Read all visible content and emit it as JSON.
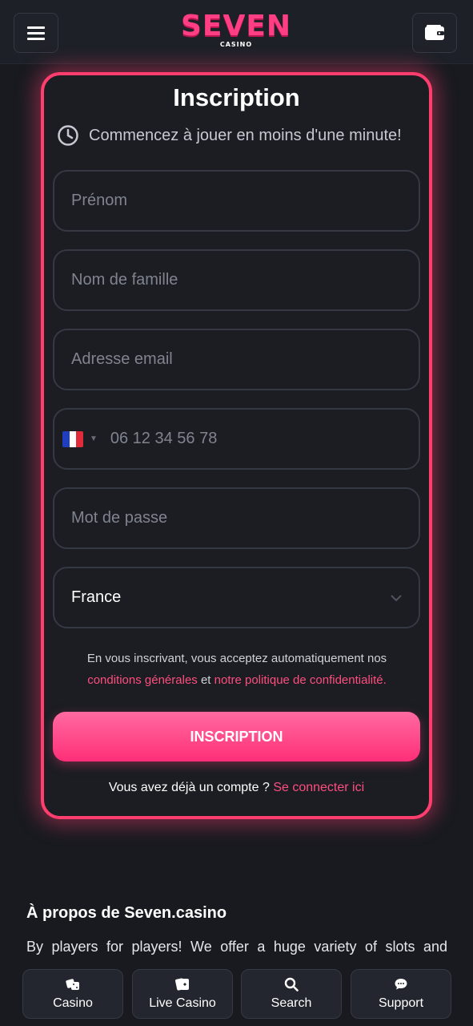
{
  "header": {
    "menu_icon": "hamburger-menu-icon",
    "logo_text": "SEVEN",
    "logo_sub": "CASINO",
    "wallet_icon": "wallet-icon",
    "brand_color": "#ff3e84"
  },
  "form": {
    "title": "Inscription",
    "subtitle": "Commencez à jouer en moins d'une minute!",
    "first_name_placeholder": "Prénom",
    "last_name_placeholder": "Nom de famille",
    "email_placeholder": "Adresse email",
    "phone_placeholder": "06 12 34 56 78",
    "phone_country_flag": "france-flag-icon",
    "password_placeholder": "Mot de passe",
    "country_value": "France",
    "terms_prefix": "En vous inscrivant, vous acceptez automatiquement nos",
    "terms_link": "conditions générales",
    "terms_and": "et",
    "privacy_link": "notre politique de confidentialité.",
    "submit_label": "INSCRIPTION",
    "login_prompt": "Vous avez déjà un compte ?",
    "login_link": "Se connecter ici",
    "accent_color": "#ff3d6e"
  },
  "about": {
    "title": "À propos de Seven.casino",
    "text": "By players for players! We offer a huge variety of slots and"
  },
  "bottom_nav": {
    "casino": "Casino",
    "live_casino": "Live Casino",
    "search": "Search",
    "support": "Support"
  }
}
